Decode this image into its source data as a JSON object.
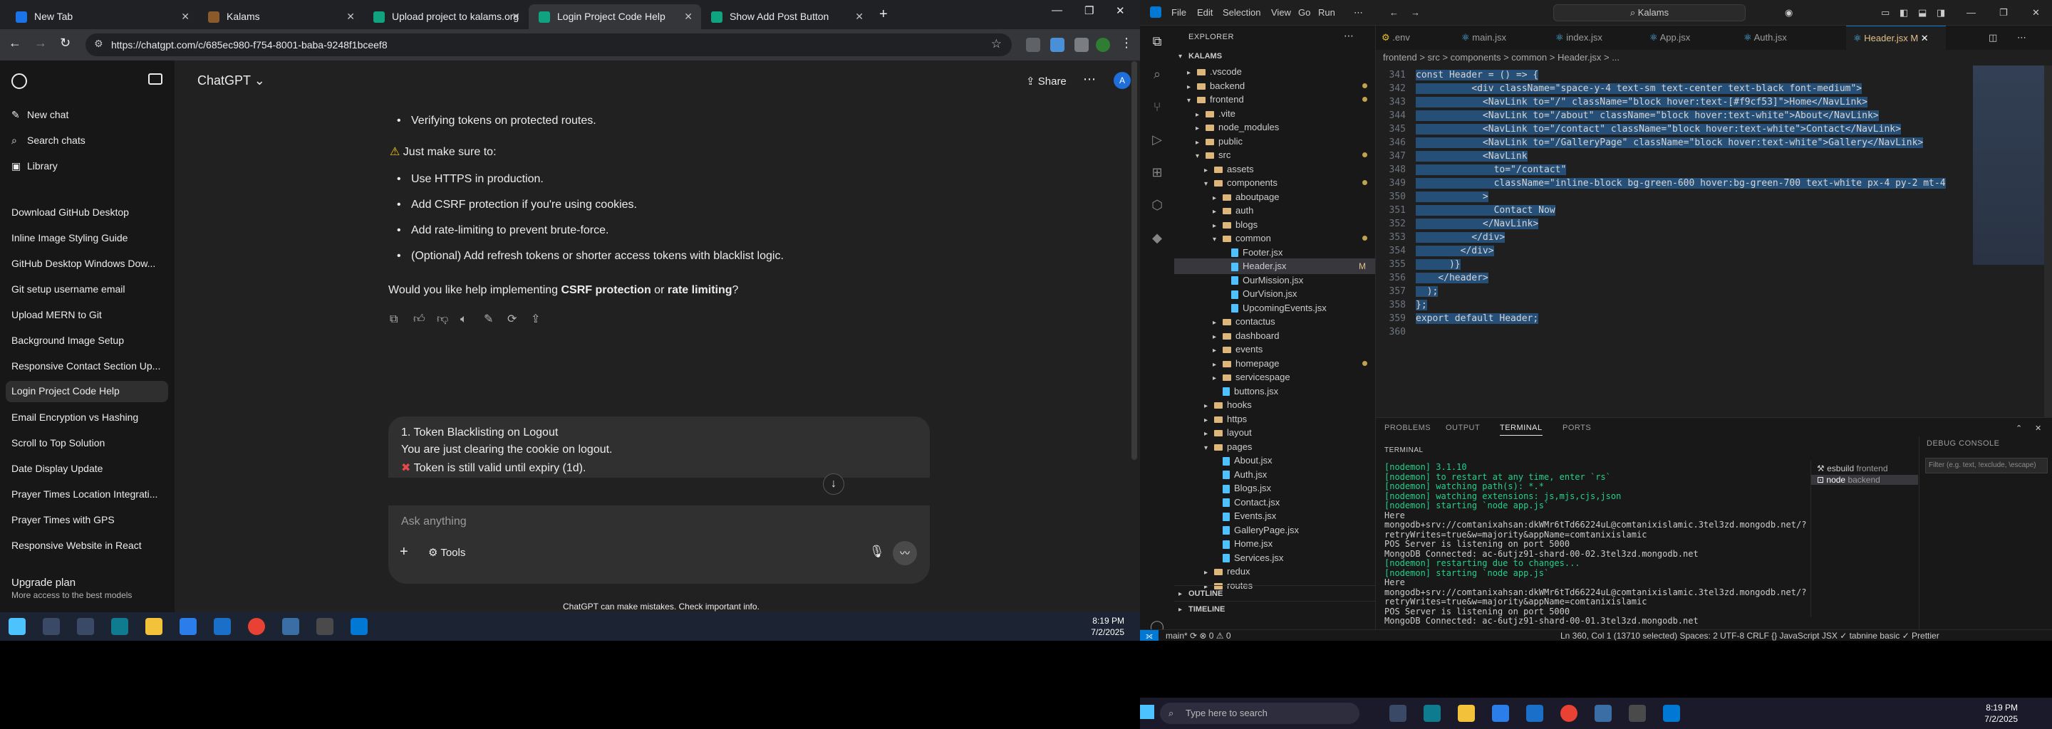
{
  "chrome": {
    "tabs": [
      {
        "title": "New Tab",
        "color": "#1a73e8"
      },
      {
        "title": "Kalams",
        "color": "#8a5a2b"
      },
      {
        "title": "Upload project to kalams.org",
        "color": "#10a37f"
      },
      {
        "title": "Login Project Code Help",
        "color": "#10a37f"
      },
      {
        "title": "Show Add Post Button",
        "color": "#10a37f"
      }
    ],
    "url": "https://chatgpt.com/c/685ec980-f754-8001-baba-9248f1bceef8"
  },
  "chatgpt": {
    "sidebar": {
      "new_chat": "New chat",
      "search": "Search chats",
      "library": "Library",
      "history": [
        "Download GitHub Desktop",
        "Inline Image Styling Guide",
        "GitHub Desktop Windows Dow...",
        "Git setup username email",
        "Upload MERN to Git",
        "Background Image Setup",
        "Responsive Contact Section Up...",
        "Login Project Code Help",
        "Email Encryption vs Hashing",
        "Scroll to Top Solution",
        "Date Display Update",
        "Prayer Times Location Integrati...",
        "Prayer Times with GPS",
        "Responsive Website in React"
      ],
      "upgrade_title": "Upgrade plan",
      "upgrade_sub": "More access to the best models"
    },
    "model": "ChatGPT",
    "share": "Share",
    "avatar": "A",
    "bullets1": [
      "Verifying tokens on protected routes."
    ],
    "warn": "Just make sure to:",
    "bullets2": [
      "Use HTTPS in production.",
      "Add CSRF protection if you're using cookies.",
      "Add rate-limiting to prevent brute-force.",
      "(Optional) Add refresh tokens or shorter access tokens with blacklist logic."
    ],
    "question_pre": "Would you like help implementing ",
    "question_b1": "CSRF protection",
    "question_mid": " or ",
    "question_b2": "rate limiting",
    "question_post": "?",
    "user_lines": [
      "1. Token Blacklisting on Logout",
      "You are just clearing the cookie on logout.",
      "Token is still valid until expiry (1d)."
    ],
    "composer_placeholder": "Ask anything",
    "tools": "Tools",
    "disclaimer": "ChatGPT can make mistakes. Check important info."
  },
  "taskbar_left": {
    "time": "8:19 PM",
    "date": "7/2/2025"
  },
  "vscode": {
    "menu": [
      "File",
      "Edit",
      "Selection",
      "View",
      "Go",
      "Run"
    ],
    "search": "Kalams",
    "explorer_title": "EXPLORER",
    "root": "KALAMS",
    "tree": [
      {
        "name": ".vscode",
        "type": "folder",
        "indent": 1,
        "open": false
      },
      {
        "name": "backend",
        "type": "folder",
        "indent": 1,
        "open": false,
        "dot": true
      },
      {
        "name": "frontend",
        "type": "folder",
        "indent": 1,
        "open": true,
        "dot": true
      },
      {
        "name": ".vite",
        "type": "folder",
        "indent": 2,
        "open": false
      },
      {
        "name": "node_modules",
        "type": "folder",
        "indent": 2,
        "open": false
      },
      {
        "name": "public",
        "type": "folder",
        "indent": 2,
        "open": false
      },
      {
        "name": "src",
        "type": "folder",
        "indent": 2,
        "open": true,
        "dot": true
      },
      {
        "name": "assets",
        "type": "folder",
        "indent": 3,
        "open": false
      },
      {
        "name": "components",
        "type": "folder",
        "indent": 3,
        "open": true,
        "dot": true
      },
      {
        "name": "aboutpage",
        "type": "folder",
        "indent": 4,
        "open": false
      },
      {
        "name": "auth",
        "type": "folder",
        "indent": 4,
        "open": false
      },
      {
        "name": "blogs",
        "type": "folder",
        "indent": 4,
        "open": false
      },
      {
        "name": "common",
        "type": "folder",
        "indent": 4,
        "open": true,
        "dot": true
      },
      {
        "name": "Footer.jsx",
        "type": "file",
        "indent": 5
      },
      {
        "name": "Header.jsx",
        "type": "file",
        "indent": 5,
        "mark": "M",
        "selected": true
      },
      {
        "name": "OurMission.jsx",
        "type": "file",
        "indent": 5
      },
      {
        "name": "OurVision.jsx",
        "type": "file",
        "indent": 5
      },
      {
        "name": "UpcomingEvents.jsx",
        "type": "file",
        "indent": 5
      },
      {
        "name": "contactus",
        "type": "folder",
        "indent": 4,
        "open": false
      },
      {
        "name": "dashboard",
        "type": "folder",
        "indent": 4,
        "open": false
      },
      {
        "name": "events",
        "type": "folder",
        "indent": 4,
        "open": false
      },
      {
        "name": "homepage",
        "type": "folder",
        "indent": 4,
        "open": false,
        "dot": true
      },
      {
        "name": "servicespage",
        "type": "folder",
        "indent": 4,
        "open": false
      },
      {
        "name": "buttons.jsx",
        "type": "file",
        "indent": 4
      },
      {
        "name": "hooks",
        "type": "folder",
        "indent": 3,
        "open": false
      },
      {
        "name": "https",
        "type": "folder",
        "indent": 3,
        "open": false
      },
      {
        "name": "layout",
        "type": "folder",
        "indent": 3,
        "open": false
      },
      {
        "name": "pages",
        "type": "folder",
        "indent": 3,
        "open": true
      },
      {
        "name": "About.jsx",
        "type": "file",
        "indent": 4
      },
      {
        "name": "Auth.jsx",
        "type": "file",
        "indent": 4
      },
      {
        "name": "Blogs.jsx",
        "type": "file",
        "indent": 4
      },
      {
        "name": "Contact.jsx",
        "type": "file",
        "indent": 4
      },
      {
        "name": "Events.jsx",
        "type": "file",
        "indent": 4
      },
      {
        "name": "GalleryPage.jsx",
        "type": "file",
        "indent": 4
      },
      {
        "name": "Home.jsx",
        "type": "file",
        "indent": 4
      },
      {
        "name": "Services.jsx",
        "type": "file",
        "indent": 4
      },
      {
        "name": "redux",
        "type": "folder",
        "indent": 3,
        "open": false
      },
      {
        "name": "routes",
        "type": "folder",
        "indent": 3,
        "open": false
      }
    ],
    "outline": "OUTLINE",
    "timeline": "TIMELINE",
    "editor_tabs": [
      ".env",
      "main.jsx",
      "index.jsx",
      "App.jsx",
      "Auth.jsx",
      "Header.jsx M"
    ],
    "breadcrumb": "frontend > src > components > common > Header.jsx > ...",
    "code": [
      {
        "n": "341",
        "t": "const Header = () => {"
      },
      {
        "n": "342",
        "t": "          <div className=\"space-y-4 text-sm text-center text-black font-medium\">"
      },
      {
        "n": "343",
        "t": "            <NavLink to=\"/\" className=\"block hover:text-[#f9cf53]\">Home</NavLink>"
      },
      {
        "n": "344",
        "t": "            <NavLink to=\"/about\" className=\"block hover:text-white\">About</NavLink>"
      },
      {
        "n": "345",
        "t": "            <NavLink to=\"/contact\" className=\"block hover:text-white\">Contact</NavLink>"
      },
      {
        "n": "346",
        "t": "            <NavLink to=\"/GalleryPage\" className=\"block hover:text-white\">Gallery</NavLink>"
      },
      {
        "n": "347",
        "t": "            <NavLink"
      },
      {
        "n": "348",
        "t": "              to=\"/contact\""
      },
      {
        "n": "349",
        "t": "              className=\"inline-block bg-green-600 hover:bg-green-700 text-white px-4 py-2 mt-4"
      },
      {
        "n": "350",
        "t": "            >"
      },
      {
        "n": "351",
        "t": "              Contact Now"
      },
      {
        "n": "352",
        "t": "            </NavLink>"
      },
      {
        "n": "353",
        "t": "          </div>"
      },
      {
        "n": "354",
        "t": "        </div>"
      },
      {
        "n": "355",
        "t": "      )}"
      },
      {
        "n": "356",
        "t": "    </header>"
      },
      {
        "n": "357",
        "t": "  );"
      },
      {
        "n": "358",
        "t": "};"
      },
      {
        "n": "359",
        "t": "export default Header;"
      },
      {
        "n": "360",
        "t": ""
      }
    ],
    "panel_tabs": [
      "PROBLEMS",
      "OUTPUT",
      "TERMINAL",
      "PORTS"
    ],
    "terminal_label": "TERMINAL",
    "terminal": [
      {
        "t": "[nodemon] 3.1.10",
        "g": true
      },
      {
        "t": "[nodemon] to restart at any time, enter `rs`",
        "g": true
      },
      {
        "t": "[nodemon] watching path(s): *.*",
        "g": true
      },
      {
        "t": "[nodemon] watching extensions: js,mjs,cjs,json",
        "g": true
      },
      {
        "t": "[nodemon] starting `node app.js`",
        "g": true
      },
      {
        "t": "Here",
        "g": false
      },
      {
        "t": "mongodb+srv://comtanixahsan:dkWMr6tTd66224uL@comtanixislamic.3tel3zd.mongodb.net/?",
        "g": false
      },
      {
        "t": "retryWrites=true&w=majority&appName=comtanixislamic",
        "g": false
      },
      {
        "t": "POS Server is listening on port 5000",
        "g": false
      },
      {
        "t": "MongoDB Connected: ac-6utjz91-shard-00-02.3tel3zd.mongodb.net",
        "g": false
      },
      {
        "t": "[nodemon] restarting due to changes...",
        "g": true
      },
      {
        "t": "[nodemon] starting `node app.js`",
        "g": true
      },
      {
        "t": "Here",
        "g": false
      },
      {
        "t": "mongodb+srv://comtanixahsan:dkWMr6tTd66224uL@comtanixislamic.3tel3zd.mongodb.net/?",
        "g": false
      },
      {
        "t": "retryWrites=true&w=majority&appName=comtanixislamic",
        "g": false
      },
      {
        "t": "POS Server is listening on port 5000",
        "g": false
      },
      {
        "t": "MongoDB Connected: ac-6utjz91-shard-00-01.3tel3zd.mongodb.net",
        "g": false
      }
    ],
    "term_sessions": [
      {
        "icon": "⚒",
        "label": "esbuild",
        "sub": "frontend"
      },
      {
        "icon": "⊡",
        "label": "node",
        "sub": "backend"
      }
    ],
    "debug_console": "DEBUG CONSOLE",
    "debug_filter": "Filter (e.g. text, !exclude, \\escape)",
    "status_left": "main*  ⟳  ⊗ 0 ⚠ 0",
    "status_right": "Ln 360, Col 1 (13710 selected)   Spaces: 2   UTF-8   CRLF   {} JavaScript JSX   ✓ tabnine basic   ✓ Prettier",
    "taskbar_search": "Type here to search",
    "time": "8:19 PM",
    "date": "7/2/2025"
  }
}
